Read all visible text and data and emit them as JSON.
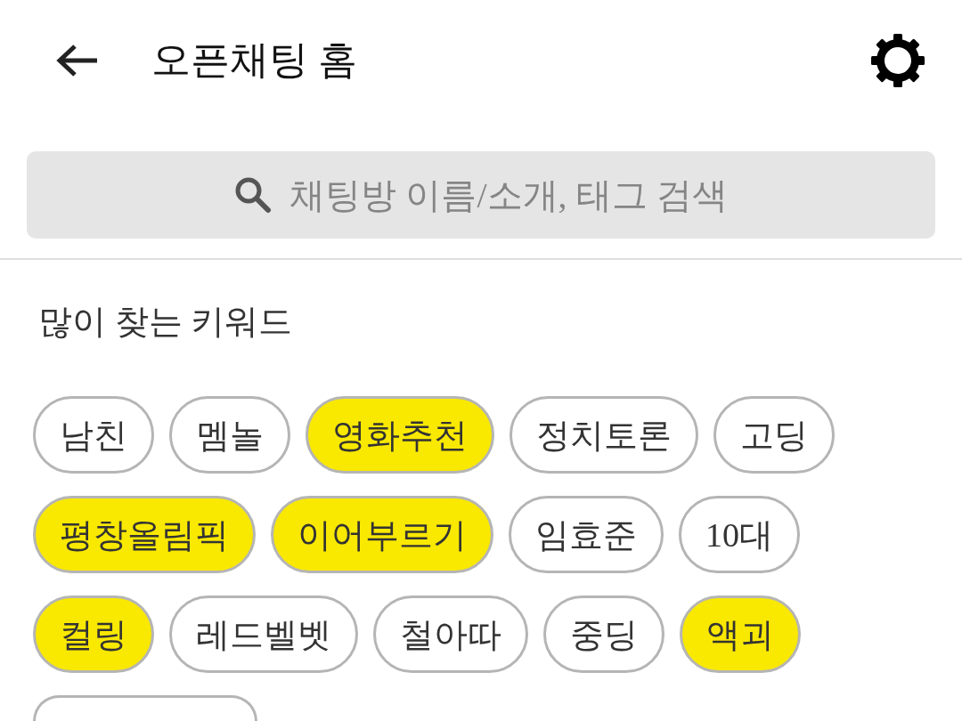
{
  "header": {
    "title": "오픈채팅 홈"
  },
  "search": {
    "placeholder": "채팅방 이름/소개, 태그 검색"
  },
  "popular_keywords": {
    "title": "많이 찾는 키워드",
    "keywords": [
      {
        "label": "남친",
        "highlighted": false
      },
      {
        "label": "멤놀",
        "highlighted": false
      },
      {
        "label": "영화추천",
        "highlighted": true
      },
      {
        "label": "정치토론",
        "highlighted": false
      },
      {
        "label": "고딩",
        "highlighted": false
      },
      {
        "label": "평창올림픽",
        "highlighted": true
      },
      {
        "label": "이어부르기",
        "highlighted": true
      },
      {
        "label": "임효준",
        "highlighted": false
      },
      {
        "label": "10대",
        "highlighted": false
      },
      {
        "label": "컬링",
        "highlighted": true
      },
      {
        "label": "레드벨벳",
        "highlighted": false
      },
      {
        "label": "철아따",
        "highlighted": false
      },
      {
        "label": "중딩",
        "highlighted": false
      },
      {
        "label": "액괴",
        "highlighted": true
      },
      {
        "highlighted": false
      }
    ]
  }
}
